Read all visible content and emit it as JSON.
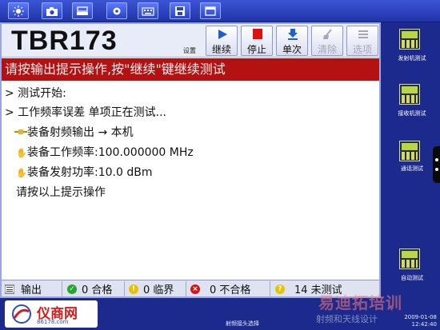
{
  "toolbar": {
    "icons": [
      "brightness-icon",
      "camera-icon",
      "tray-icon",
      "gear-icon",
      "keyboard-icon",
      "save-icon",
      "window-icon"
    ]
  },
  "header": {
    "model": "TBR173",
    "settings_label": "设置"
  },
  "controls": {
    "continue": "继续",
    "stop": "停止",
    "single": "单次",
    "clear": "清除",
    "options": "选项"
  },
  "prompt": "请按输出提示操作,按\"继续\"键继续测试",
  "log": {
    "line1": "> 测试开始:",
    "line2": "> 工作频率误差 单项正在测试...",
    "line3": "装备射频输出 → 本机",
    "line4": "装备工作频率:100.000000 MHz",
    "line5": "装备发射功率:10.0 dBm",
    "line6": "请按以上提示操作"
  },
  "status": {
    "output": "输出",
    "pass": "0 合格",
    "limit": "0 临界",
    "fail": "0 不合格",
    "untested": "14 未测试"
  },
  "side": {
    "tx_test": "发射机测试",
    "rx_test": "接收机测试",
    "call_test": "通话测试",
    "auto_test": "自动测试"
  },
  "footer": {
    "center": "射频接头选择",
    "date": "2009-01-08",
    "time": "12:42:40"
  },
  "branding": {
    "logo_text": "仪商网",
    "logo_sub": "86178.com",
    "watermark": "易迪拓培训",
    "watermark_sub": "射频和天线设计"
  },
  "colors": {
    "prompt_bg": "#b41212",
    "frame": "#1b2a8c",
    "continue_icon": "#1a5fd8",
    "stop_icon": "#e01010"
  }
}
